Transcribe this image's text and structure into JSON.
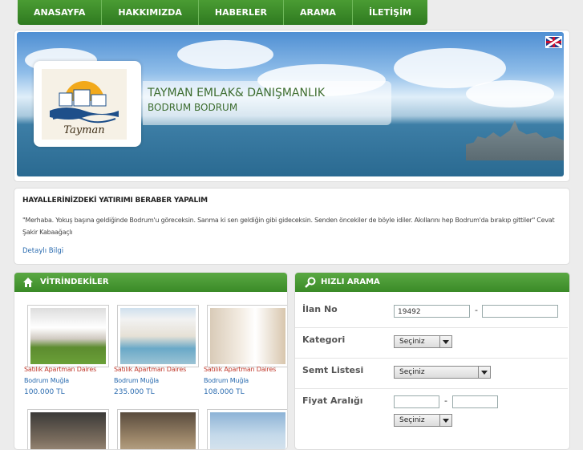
{
  "nav": {
    "items": [
      {
        "label": "ANASAYFA"
      },
      {
        "label": "HAKKIMIZDA"
      },
      {
        "label": "HABERLER"
      },
      {
        "label": "ARAMA"
      },
      {
        "label": "İLETİŞİM"
      }
    ]
  },
  "header": {
    "company": "TAYMAN EMLAK& DANIŞMANLIK",
    "location": "BODRUM BODRUM",
    "logo_text": "Tayman",
    "language_flag": "uk-flag-icon"
  },
  "welcome": {
    "title": "HAYALLERİNİZDEKİ YATIRIMI BERABER YAPALIM",
    "text": "\"Merhaba. Yokuş başına geldiğinde Bodrum'u göreceksin. Sanma ki sen geldiğin gibi gideceksin. Senden öncekiler de böyle idiler. Akıllarını hep Bodrum'da bırakıp gittiler\" Cevat Şakir Kabaağaçlı",
    "link": "Detaylı Bilgi"
  },
  "showcase": {
    "title": "VİTRİNDEKİLER",
    "icon": "home-icon",
    "listings": [
      {
        "title": "Satılık Apartman Daires",
        "location": "Bodrum Muğla",
        "price": "100.000 TL"
      },
      {
        "title": "Satılık Apartman Daires",
        "location": "Bodrum Muğla",
        "price": "235.000 TL"
      },
      {
        "title": "Satılık Apartman Daires",
        "location": "Bodrum Muğla",
        "price": "108.000 TL"
      }
    ]
  },
  "quick_search": {
    "title": "HIZLI ARAMA",
    "icon": "search-icon",
    "ilan_no_label": "İlan No",
    "ilan_no_value": "19492",
    "ilan_no_dash": "-",
    "kategori_label": "Kategori",
    "kategori_value": "Seçiniz",
    "semt_label": "Semt Listesi",
    "semt_value": "Seçiniz",
    "fiyat_label": "Fiyat Aralığı",
    "fiyat_dash": "-",
    "fiyat_currency_value": "Seçiniz"
  },
  "colors": {
    "nav_green": "#3a8a27",
    "price_blue": "#2b6cb0",
    "listing_red": "#c0392b"
  }
}
